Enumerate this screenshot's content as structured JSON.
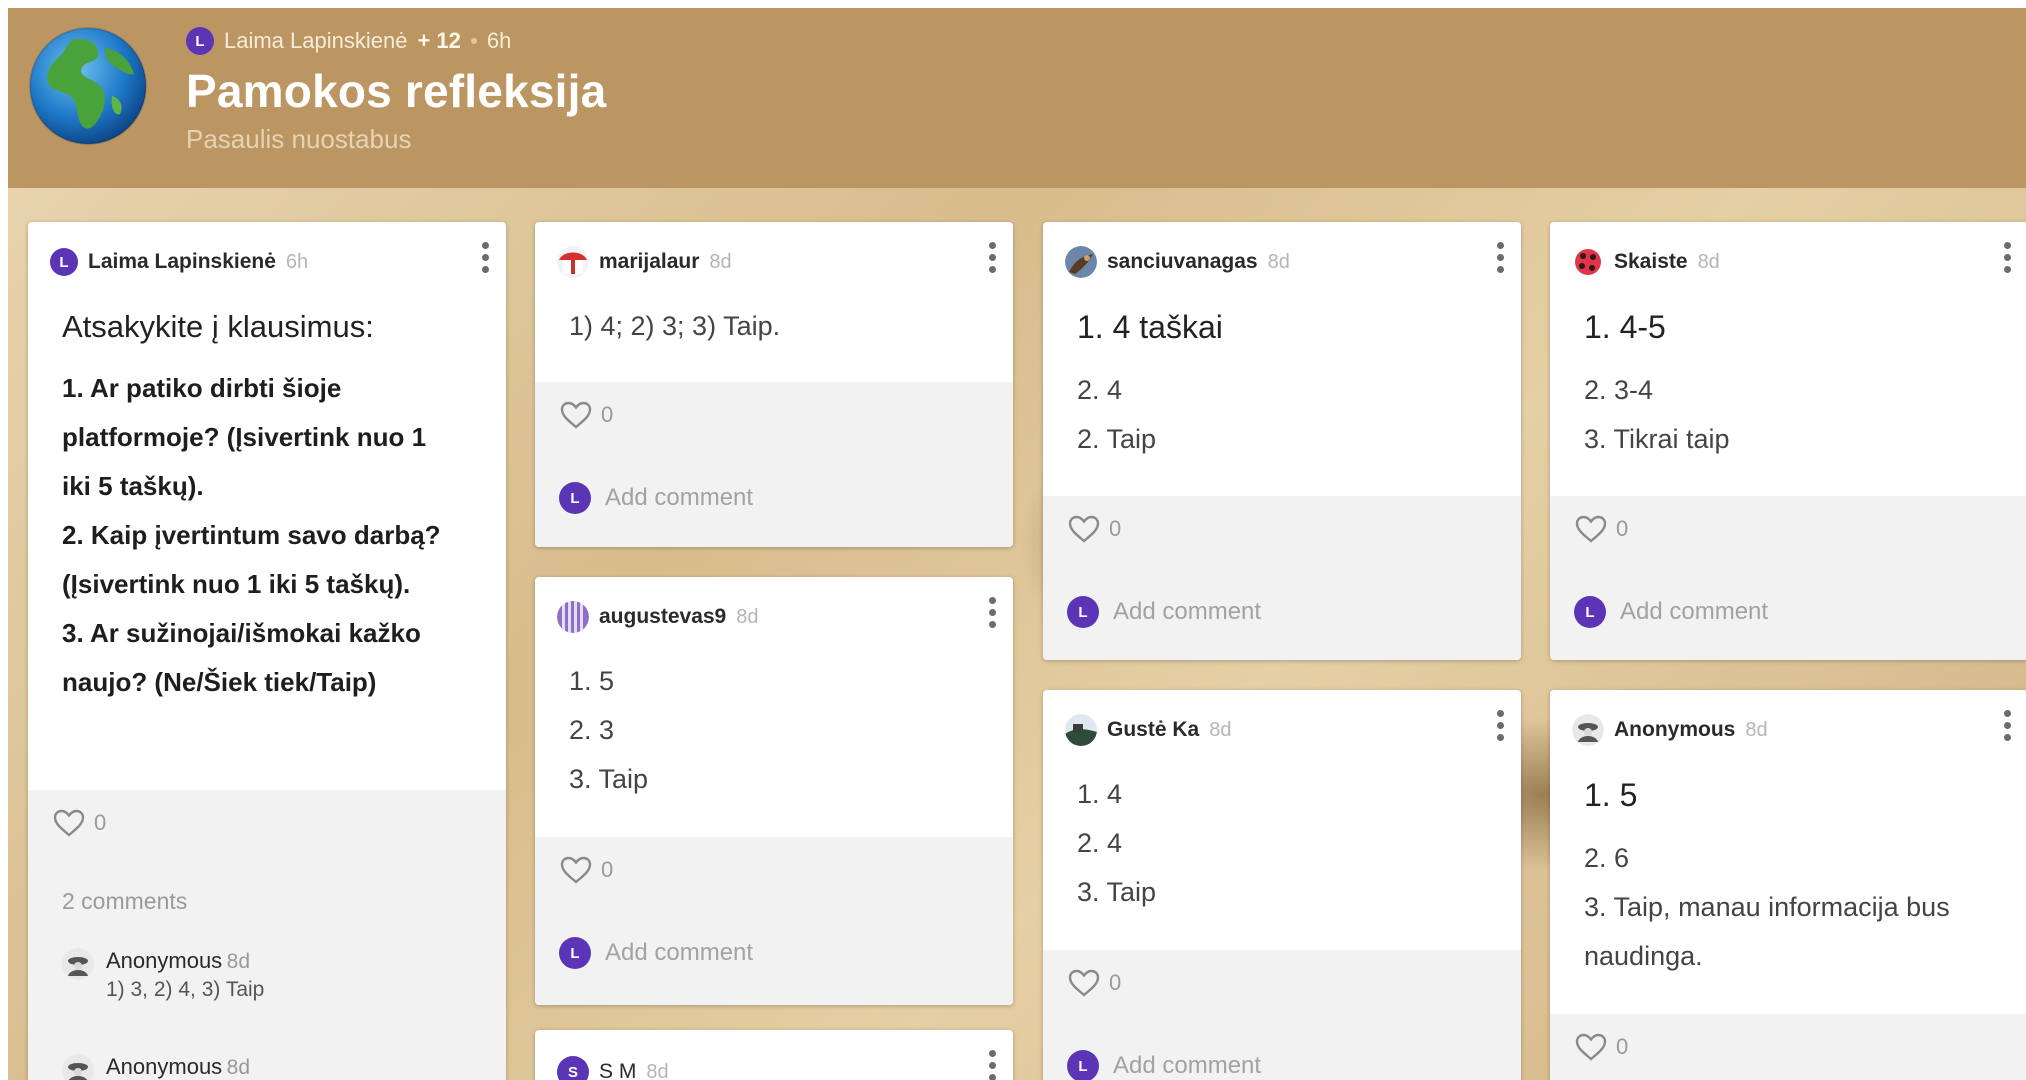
{
  "header": {
    "author_initial": "L",
    "author": "Laima Lapinskienė",
    "contributors": "+ 12",
    "age": "6h",
    "title": "Pamokos refleksija",
    "subtitle": "Pasaulis nuostabus",
    "globe_icon": "globe-icon"
  },
  "colors": {
    "header_bg": "#bb9663",
    "avatar_purple": "#5b35b5",
    "card_bg": "#ffffff",
    "card_footer_bg": "#f2f2f2"
  },
  "common": {
    "add_comment": "Add comment",
    "user_initial": "L"
  },
  "posts": {
    "laima": {
      "author": "Laima Lapinskienė",
      "initial": "L",
      "age": "6h",
      "heading": "Atsakykite į klausimus:",
      "lines": [
        "1. Ar patiko dirbti šioje",
        "platformoje? (Įsivertink nuo 1",
        "iki 5 taškų).",
        "2. Kaip įvertintum savo darbą?",
        "(Įsivertink nuo 1 iki 5 taškų).",
        "3. Ar sužinojai/išmokai kažko",
        "naujo? (Ne/Šiek tiek/Taip)"
      ],
      "likes": "0",
      "comments_count": "2 comments",
      "comments": [
        {
          "author": "Anonymous",
          "age": "8d",
          "text": "1) 3, 2) 4, 3) Taip"
        },
        {
          "author": "Anonymous",
          "age": "8d",
          "text": ""
        }
      ]
    },
    "marijalaur": {
      "author": "marijalaur",
      "age": "8d",
      "lines": [
        "1) 4; 2) 3; 3) Taip."
      ],
      "likes": "0"
    },
    "augustevas9": {
      "author": "augustevas9",
      "age": "8d",
      "lines": [
        "1. 5",
        "2. 3",
        "3. Taip"
      ],
      "likes": "0"
    },
    "sm": {
      "author": "S M",
      "initial": "S",
      "age": "8d"
    },
    "sanciuvanagas": {
      "author": "sanciuvanagas",
      "age": "8d",
      "heading": "1. 4 taškai",
      "lines": [
        "2. 4",
        "2. Taip"
      ],
      "likes": "0"
    },
    "guste": {
      "author": "Gustė Ka",
      "age": "8d",
      "lines": [
        "1. 4",
        "2. 4",
        "3. Taip"
      ],
      "likes": "0"
    },
    "skaiste": {
      "author": "Skaiste",
      "age": "8d",
      "heading": "1. 4-5",
      "lines": [
        "2. 3-4",
        "3. Tikrai taip"
      ],
      "likes": "0"
    },
    "anon": {
      "author": "Anonymous",
      "age": "8d",
      "heading": "1. 5",
      "lines": [
        "2. 6",
        "3. Taip, manau informacija bus",
        "naudinga."
      ],
      "likes": "0"
    }
  }
}
